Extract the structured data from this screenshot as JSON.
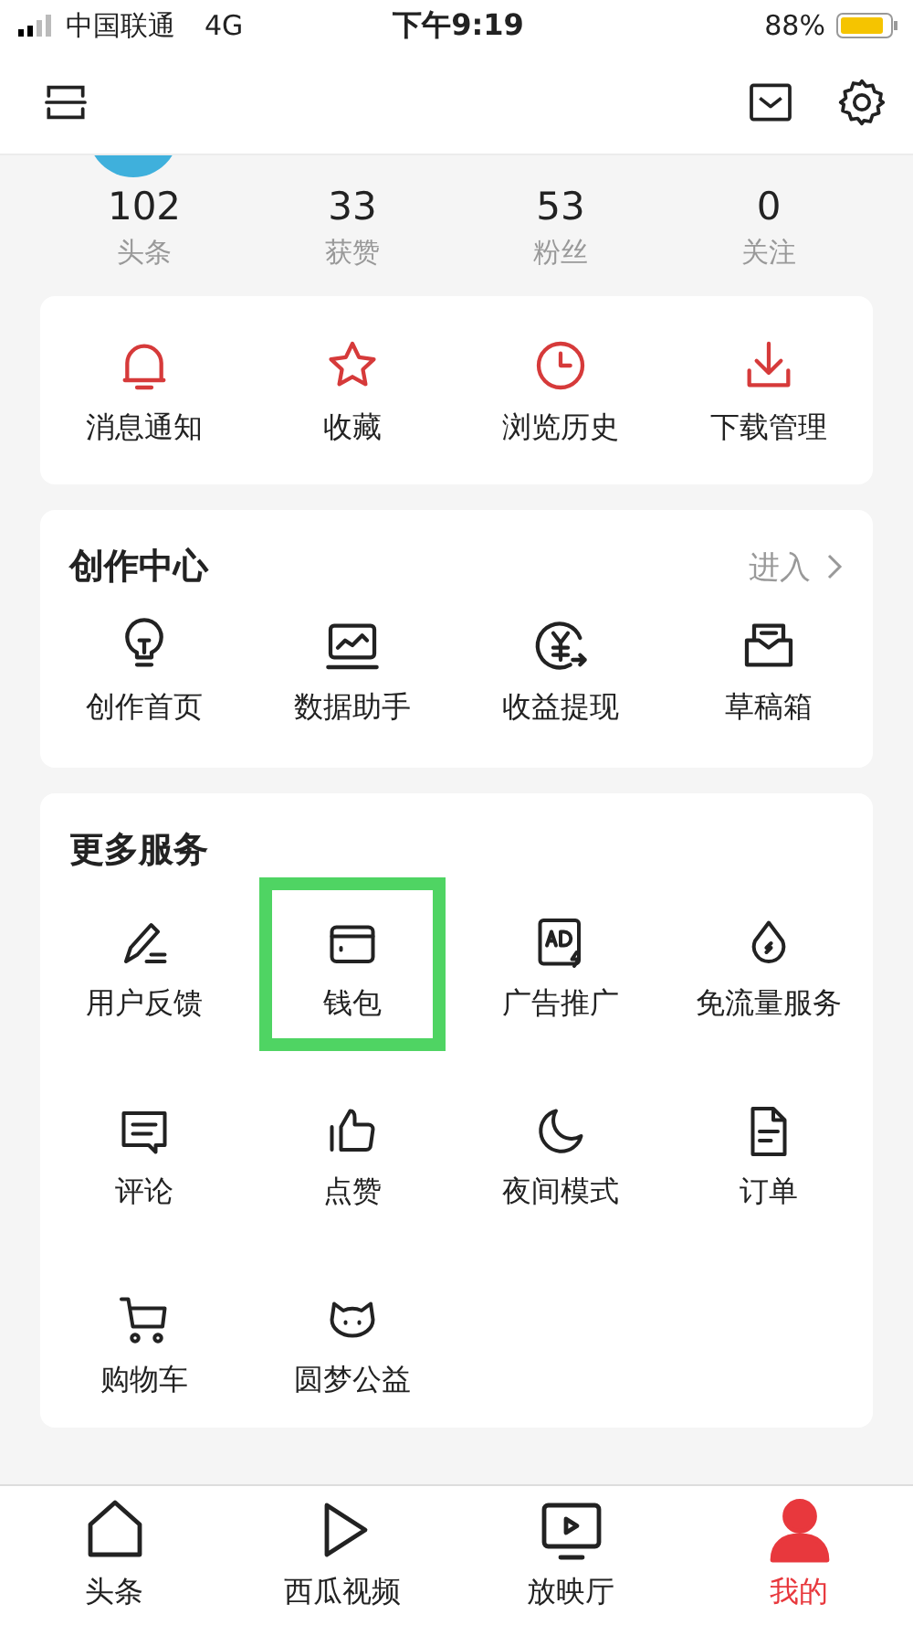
{
  "status_bar": {
    "carrier": "中国联通",
    "network": "4G",
    "time": "下午9:19",
    "battery": "88%"
  },
  "stats": [
    {
      "value": "102",
      "label": "头条"
    },
    {
      "value": "33",
      "label": "获赞"
    },
    {
      "value": "53",
      "label": "粉丝"
    },
    {
      "value": "0",
      "label": "关注"
    }
  ],
  "quick_actions": [
    {
      "label": "消息通知"
    },
    {
      "label": "收藏"
    },
    {
      "label": "浏览历史"
    },
    {
      "label": "下载管理"
    }
  ],
  "creation_center": {
    "title": "创作中心",
    "enter_link": "进入",
    "items": [
      {
        "label": "创作首页"
      },
      {
        "label": "数据助手"
      },
      {
        "label": "收益提现"
      },
      {
        "label": "草稿箱"
      }
    ]
  },
  "more_services": {
    "title": "更多服务",
    "items": [
      {
        "label": "用户反馈",
        "highlighted": false
      },
      {
        "label": "钱包",
        "highlighted": true
      },
      {
        "label": "广告推广",
        "highlighted": false
      },
      {
        "label": "免流量服务",
        "highlighted": false
      },
      {
        "label": "评论",
        "highlighted": false
      },
      {
        "label": "点赞",
        "highlighted": false
      },
      {
        "label": "夜间模式",
        "highlighted": false
      },
      {
        "label": "订单",
        "highlighted": false
      },
      {
        "label": "购物车",
        "highlighted": false
      },
      {
        "label": "圆梦公益",
        "highlighted": false
      }
    ]
  },
  "tab_bar": [
    {
      "label": "头条",
      "selected": false
    },
    {
      "label": "西瓜视频",
      "selected": false
    },
    {
      "label": "放映厅",
      "selected": false
    },
    {
      "label": "我的",
      "selected": true
    }
  ]
}
